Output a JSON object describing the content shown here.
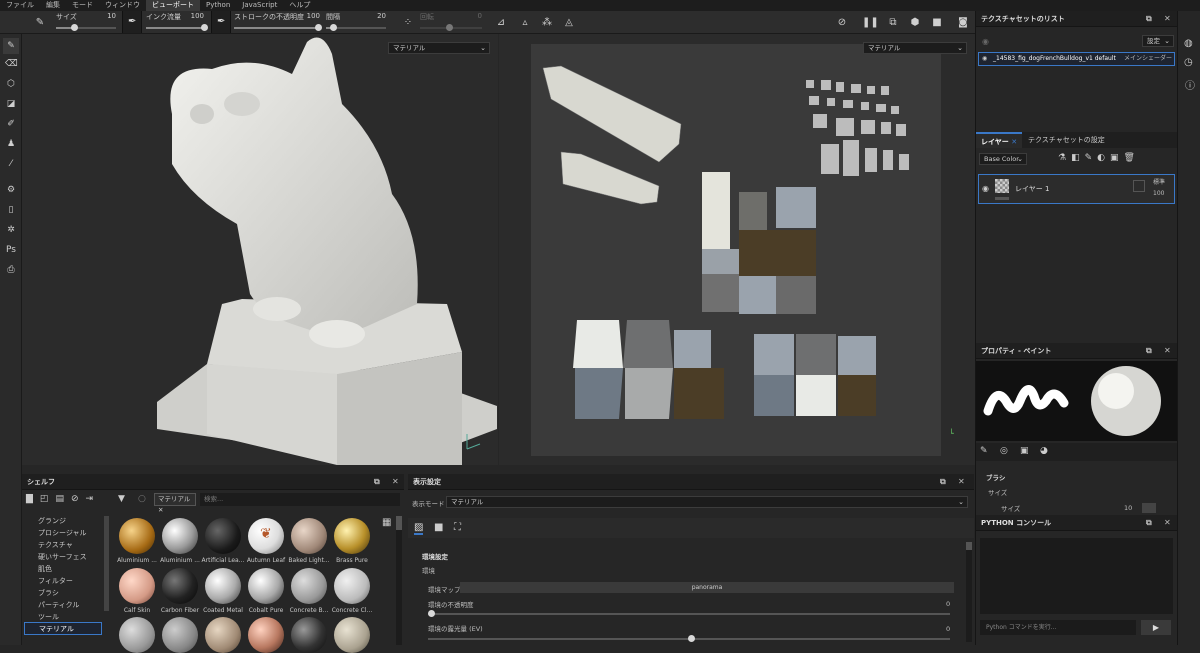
{
  "menubar": {
    "items": [
      "ファイル",
      "編集",
      "モード",
      "ウィンドウ",
      "ビューポート",
      "Python",
      "JavaScript",
      "ヘルプ"
    ],
    "active_index": 4
  },
  "toolbar": {
    "size_label": "サイズ",
    "size_value": "10",
    "flow_label": "インク流量",
    "flow_value": "100",
    "stroke_opacity_label": "ストロークの不透明度",
    "stroke_opacity_value": "100",
    "spacing_label": "間隔",
    "spacing_value": "20",
    "rotation_label": "回転",
    "rotation_value": "0"
  },
  "viewport3d": {
    "material_select": "マテリアル"
  },
  "viewport2d": {
    "material_select": "マテリアル"
  },
  "texture_set_list": {
    "title": "テクスチャセットのリスト",
    "settings_label": "設定",
    "item_name": "_14583_fig_dogFrenchBulldog_v1 default",
    "item_shader": "メインシェーダー"
  },
  "layers": {
    "tab_layers": "レイヤー",
    "tab_texset_settings": "テクスチャセットの設定",
    "channel_select": "Base Color",
    "layer_name": "レイヤー 1",
    "blend_mode": "標準",
    "opacity": "100"
  },
  "properties": {
    "title": "プロパティ - ペイント",
    "section_brush": "ブラシ",
    "row_size": "サイズ",
    "row_size_sub": "サイズ",
    "size_value": "10"
  },
  "python_console": {
    "title": "PYTHON コンソール",
    "input_placeholder": "Python コマンドを実行..."
  },
  "shelf": {
    "title": "シェルフ",
    "filter_tag": "マテリアル",
    "search_placeholder": "検索...",
    "categories": [
      "グランジ",
      "プロシージャル",
      "テクスチャ",
      "硬いサーフェス",
      "肌色",
      "フィルター",
      "ブラシ",
      "パーティクル",
      "ツール",
      "マテリアル"
    ],
    "selected_category": "マテリアル",
    "items_row1": [
      "Aluminium ...",
      "Aluminium ...",
      "Artificial Lea...",
      "Autumn Leaf",
      "Baked Light...",
      "Brass Pure"
    ],
    "items_row2": [
      "Calf Skin",
      "Carbon Fiber",
      "Coated Metal",
      "Cobalt Pure",
      "Concrete B...",
      "Concrete Cl..."
    ]
  },
  "display_settings": {
    "title": "表示設定",
    "mode_label": "表示モード",
    "mode_value": "マテリアル",
    "section_env": "環境設定",
    "sub_env": "環境",
    "env_map_label": "環境マップ",
    "env_map_value": "panorama",
    "env_opacity_label": "環境の不透明度",
    "env_opacity_value": "0",
    "env_exposure_label": "環境の露光量 (EV)",
    "env_exposure_value": "0"
  }
}
